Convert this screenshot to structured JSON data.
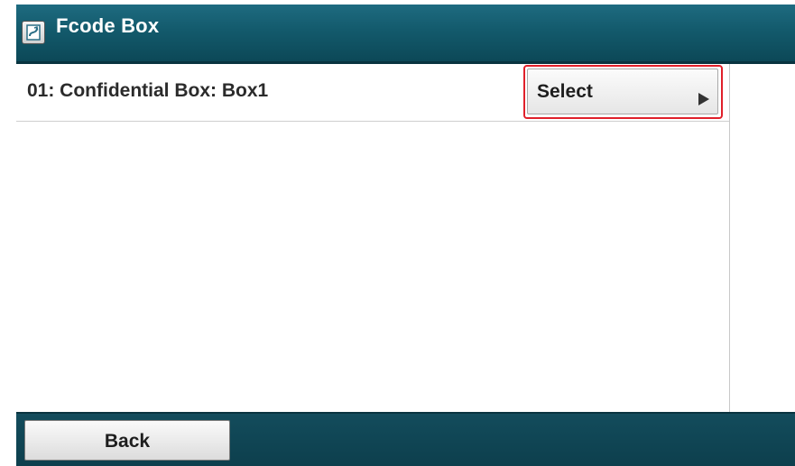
{
  "header": {
    "title": "Fcode Box",
    "icon": "fcode-box-icon"
  },
  "list": {
    "items": [
      {
        "label": "01: Confidential Box: Box1",
        "action_label": "Select",
        "action_icon": "triangle-right-icon"
      }
    ]
  },
  "footer": {
    "back_label": "Back"
  },
  "colors": {
    "titlebar": "#135a6c",
    "bottombar": "#0d3f4d",
    "highlight": "#e0202a"
  }
}
